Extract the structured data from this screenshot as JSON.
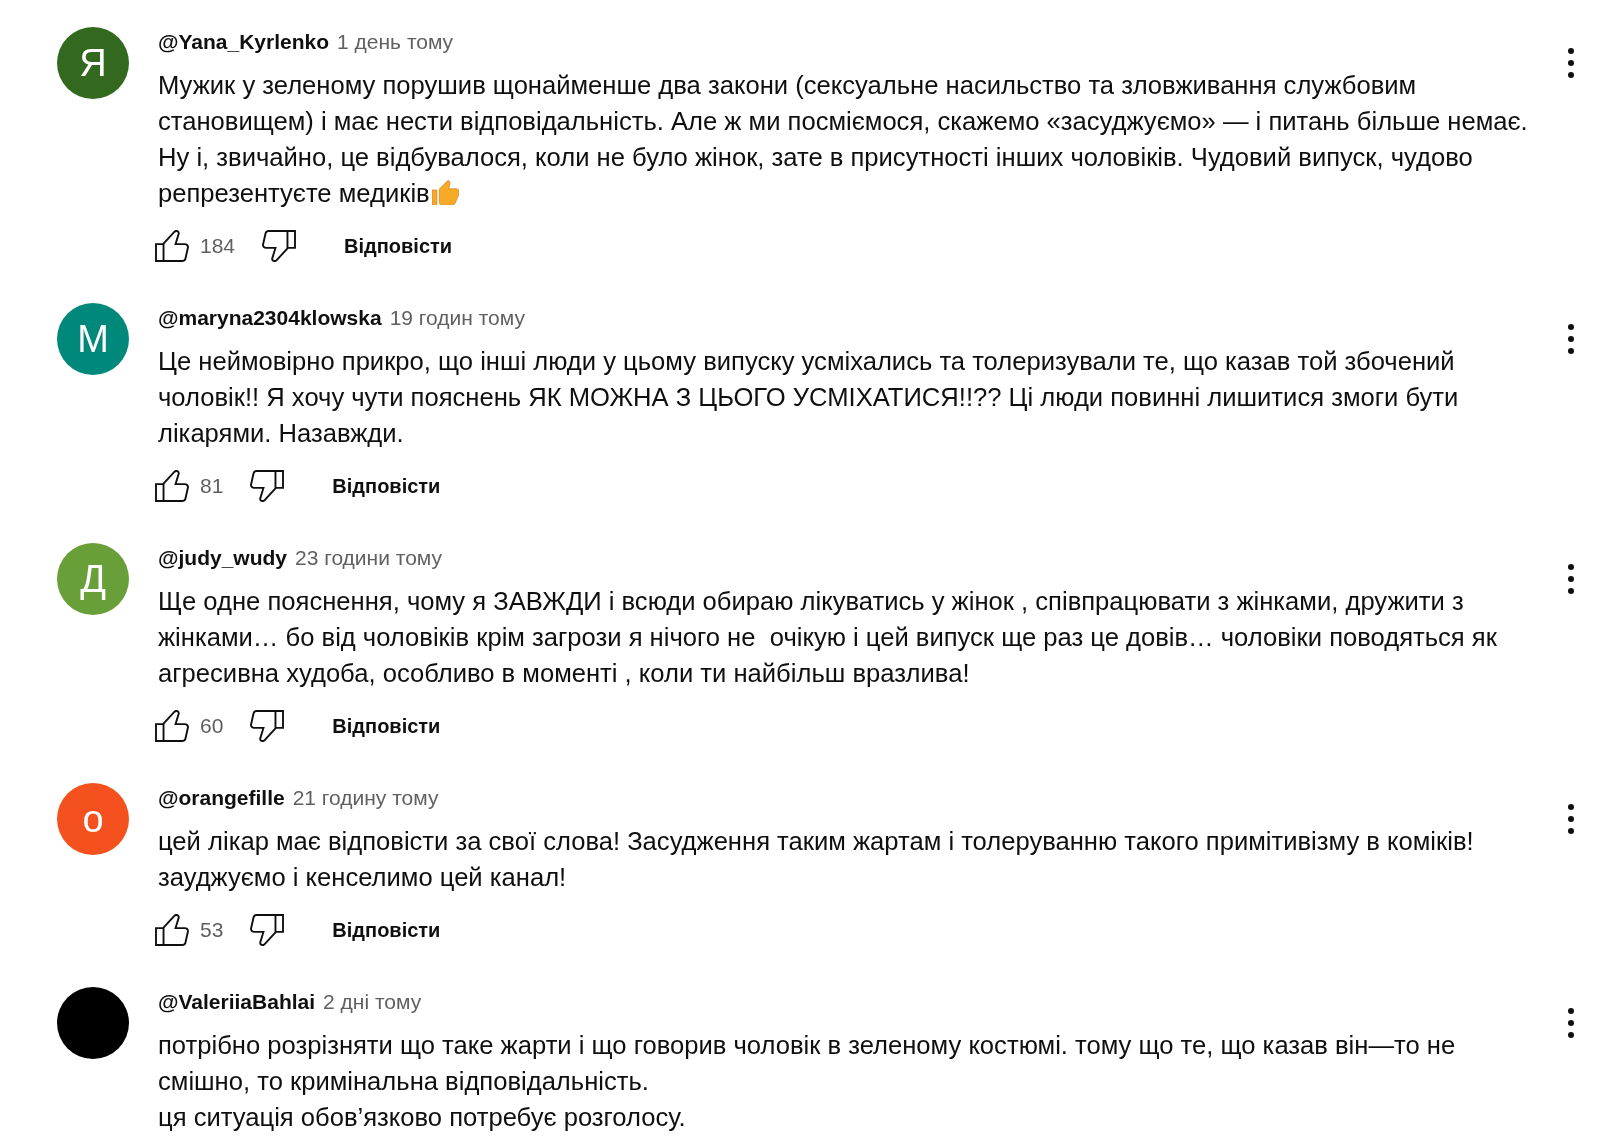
{
  "comments": [
    {
      "avatar": {
        "letter": "Я",
        "color": "#33691e"
      },
      "author": "@Yana_Kyrlenko",
      "time": "1 день тому",
      "text": "Мужик у зеленому порушив щонайменше два закони (сексуальне насильство та зловживання службовим становищем) і має нести відповідальність. Але ж ми посміємося, скажемо «засуджуємо» — і питань більше немає. Ну і, звичайно, це відбувалося, коли не було жінок, зате в присутності інших чоловіків. Чудовий випуск, чудово репрезентуєте медиків",
      "emoji_after_text": true,
      "likes": "184",
      "reply": "Відповісти"
    },
    {
      "avatar": {
        "letter": "М",
        "color": "#00897b"
      },
      "author": "@maryna2304klowska",
      "time": "19 годин тому",
      "text": "Це неймовірно прикро, що інші люди у цьому випуску усміхались та толеризували те, що казав той збочений чоловік!! Я хочу чути пояснень ЯК МОЖНА З ЦЬОГО УСМІХАТИСЯ!!?? Ці люди повинні лишитися змоги бути лікарями. Назавжди.",
      "likes": "81",
      "reply": "Відповісти"
    },
    {
      "avatar": {
        "letter": "Д",
        "color": "#689f38"
      },
      "author": "@judy_wudy",
      "time": "23 години тому",
      "text": "Ще одне пояснення, чому я ЗАВЖДИ і всюди обираю лікуватись у жінок , співпрацювати з жінками, дружити з жінками… бо від чоловіків крім загрози я нічого не  очікую і цей випуск ще раз це довів… чоловіки поводяться як агресивна худоба, особливо в моменті , коли ти найбільш вразлива!",
      "likes": "60",
      "reply": "Відповісти"
    },
    {
      "avatar": {
        "letter": "o",
        "color": "#f4511e"
      },
      "author": "@orangefille",
      "time": "21 годину тому",
      "text": "цей лікар має відповісти за свої слова! Засудження таким жартам і толеруванню такого примітивізму в коміків! зауджуємо і кенселимо цей канал!",
      "likes": "53",
      "reply": "Відповісти"
    },
    {
      "avatar": {
        "color": "#000000"
      },
      "author": "@ValeriiaBahlai",
      "time": "2 дні тому",
      "text": "потрібно розрізняти що таке жарти і що говорив чоловік в зеленому костюмі. тому що те, що казав він—то не смішно, то кримінальна відповідальність.\nця ситуація обов’язково потребує розголосу."
    }
  ]
}
